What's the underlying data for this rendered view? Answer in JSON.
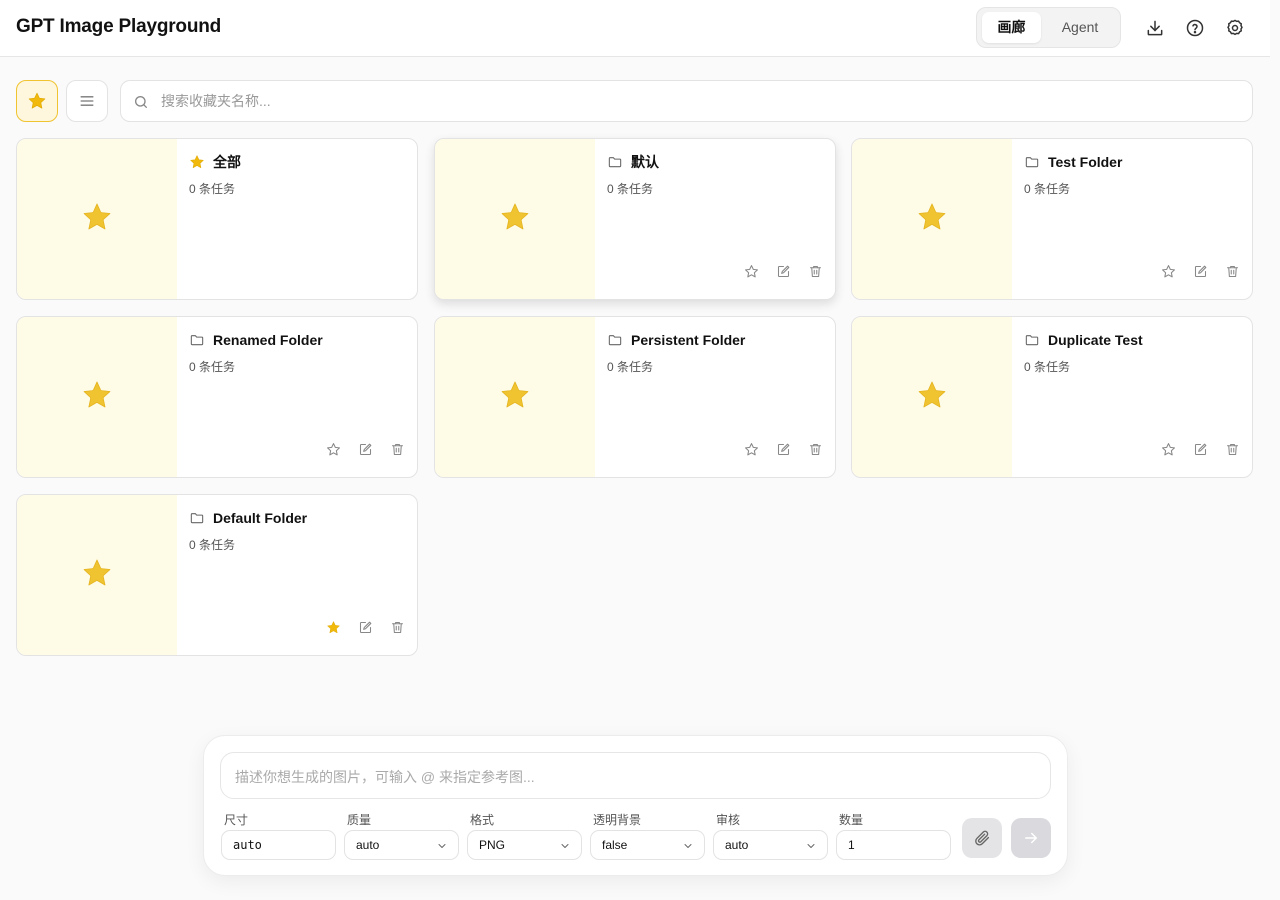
{
  "app": {
    "title": "GPT Image Playground"
  },
  "header": {
    "tabs": [
      {
        "label": "画廊",
        "active": true
      },
      {
        "label": "Agent",
        "active": false
      }
    ],
    "icons": [
      "download-icon",
      "help-icon",
      "settings-icon"
    ]
  },
  "toolbar": {
    "search_placeholder": "搜索收藏夹名称..."
  },
  "folders": [
    {
      "name": "全部",
      "count": "0 条任务",
      "icon": "star-icon",
      "favorited": true,
      "show_actions": false
    },
    {
      "name": "默认",
      "count": "0 条任务",
      "icon": "folder-icon",
      "favorited": false,
      "show_actions": true
    },
    {
      "name": "Test Folder",
      "count": "0 条任务",
      "icon": "folder-icon",
      "favorited": false,
      "show_actions": true
    },
    {
      "name": "Renamed Folder",
      "count": "0 条任务",
      "icon": "folder-icon",
      "favorited": false,
      "show_actions": true
    },
    {
      "name": "Persistent Folder",
      "count": "0 条任务",
      "icon": "folder-icon",
      "favorited": false,
      "show_actions": true
    },
    {
      "name": "Duplicate Test",
      "count": "0 条任务",
      "icon": "folder-icon",
      "favorited": false,
      "show_actions": true
    },
    {
      "name": "Default Folder",
      "count": "0 条任务",
      "icon": "folder-icon",
      "favorited": true,
      "show_actions": true
    }
  ],
  "composer": {
    "placeholder": "描述你想生成的图片，可输入 @ 来指定参考图...",
    "fields": [
      {
        "label": "尺寸",
        "value": "auto",
        "type": "input"
      },
      {
        "label": "质量",
        "value": "auto",
        "type": "select"
      },
      {
        "label": "格式",
        "value": "PNG",
        "type": "select"
      },
      {
        "label": "透明背景",
        "value": "false",
        "type": "select"
      },
      {
        "label": "审核",
        "value": "auto",
        "type": "select"
      },
      {
        "label": "数量",
        "value": "1",
        "type": "input"
      }
    ]
  },
  "colors": {
    "accent": "#f0b90b",
    "star_fill": "#f0c330",
    "thumb_bg": "#fefbe7"
  }
}
